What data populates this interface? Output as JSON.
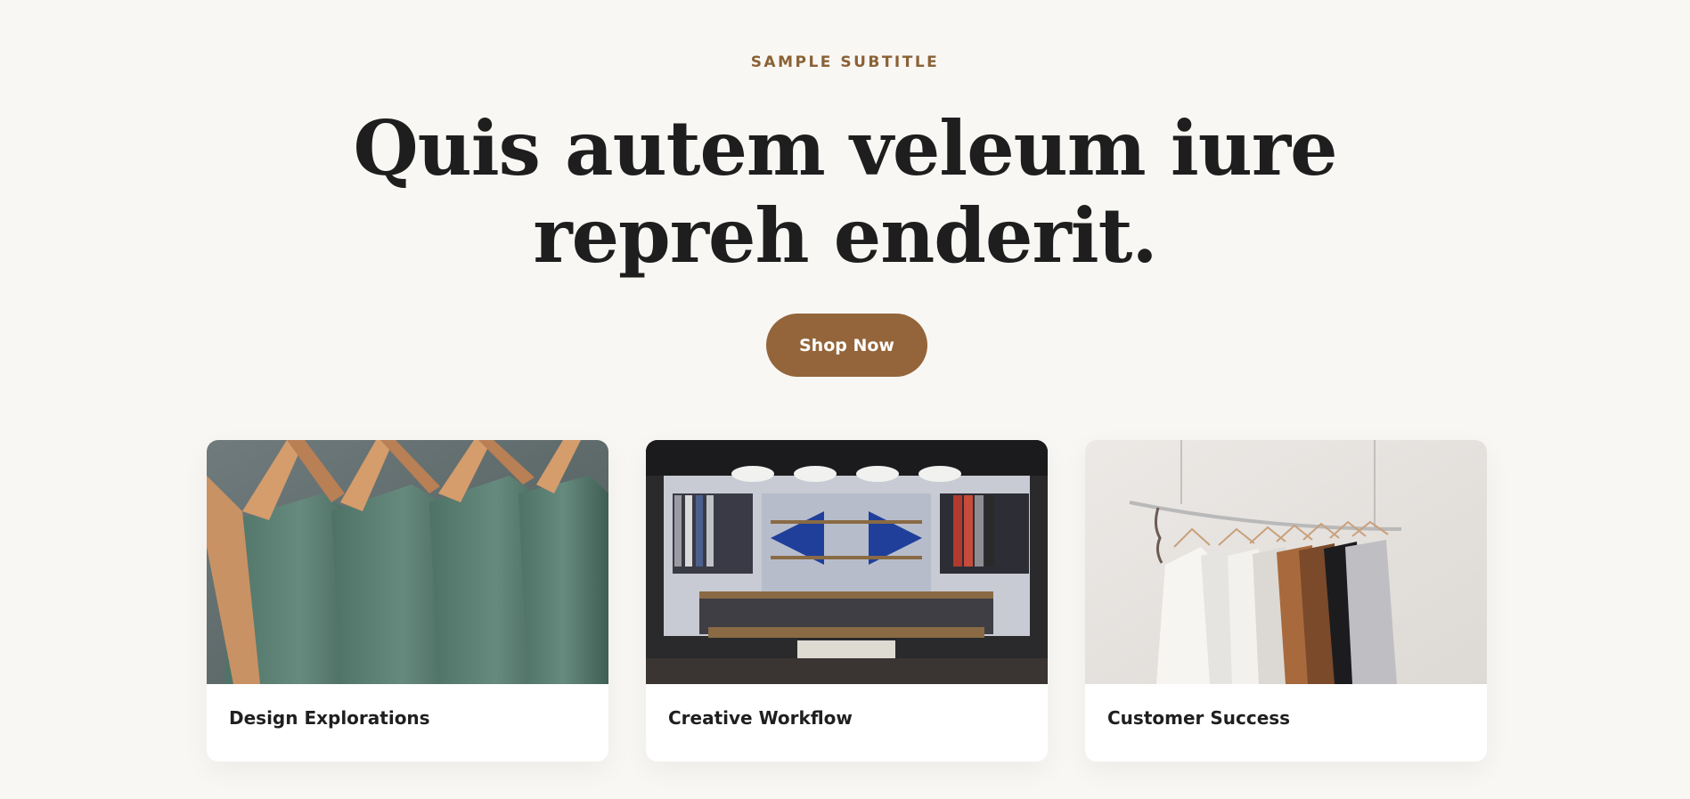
{
  "hero": {
    "subtitle": "SAMPLE SUBTITLE",
    "headline_line1": "Quis autem veleum iure",
    "headline_line2": "repreh enderit.",
    "cta_label": "Shop Now"
  },
  "colors": {
    "background": "#f9f7f4",
    "accent": "#94653a",
    "subtitle": "#8a6236",
    "text": "#1f1f1f"
  },
  "cards": [
    {
      "title": "Design Explorations",
      "image": "green-shirts-on-hangers"
    },
    {
      "title": "Creative Workflow",
      "image": "clothing-store-interior"
    },
    {
      "title": "Customer Success",
      "image": "clothes-rack-on-wall"
    }
  ]
}
